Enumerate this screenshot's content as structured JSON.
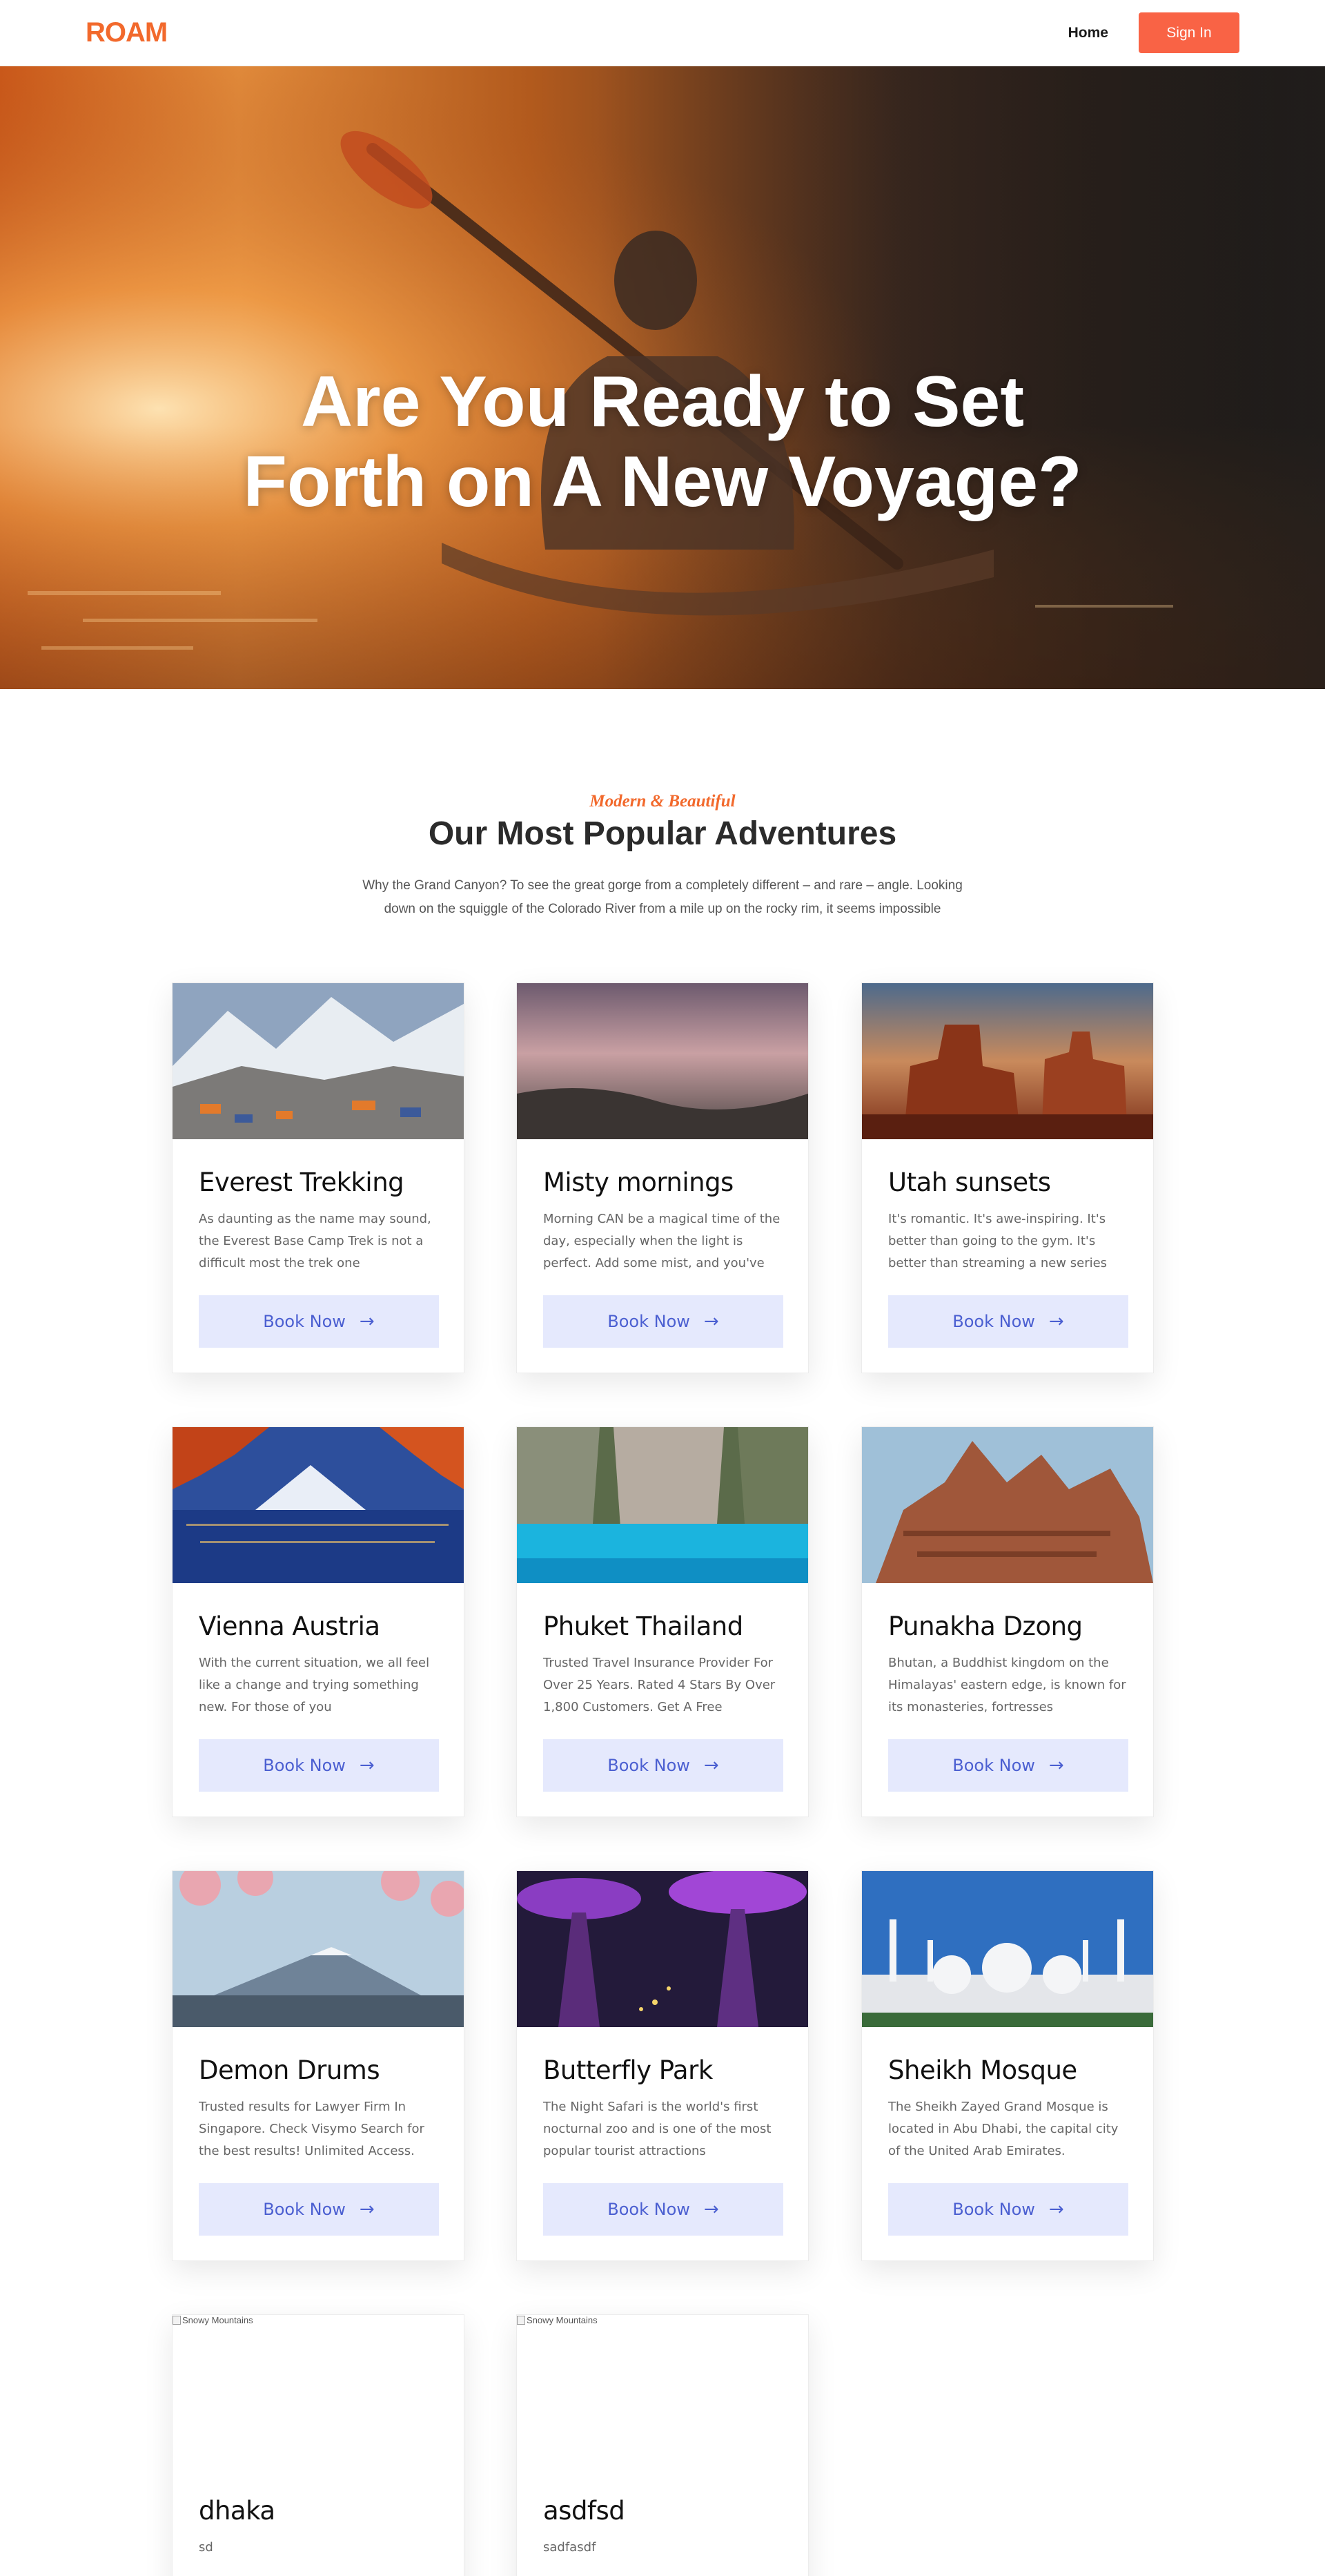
{
  "nav": {
    "logo": "ROAM",
    "home": "Home",
    "sign_in": "Sign In"
  },
  "hero": {
    "title": "Are You Ready to Set Forth on A New Voyage?"
  },
  "section": {
    "eyebrow": "Modern & Beautiful",
    "title": "Our Most Popular Adventures",
    "description": "Why the Grand Canyon? To see the great gorge from a completely different – and rare – angle. Looking down on the squiggle of the Colorado River from a mile up on the rocky rim, it seems impossible"
  },
  "cards": [
    {
      "title": "Everest Trekking",
      "text": "As daunting as the name may sound, the Everest Base Camp Trek is not a difficult most the trek one",
      "button": "Book Now",
      "image": "snowy-mountain-camp"
    },
    {
      "title": "Misty mornings",
      "text": "Morning CAN be a magical time of the day, especially when the light is perfect. Add some mist, and you've",
      "button": "Book Now",
      "image": "misty-landscape"
    },
    {
      "title": "Utah sunsets",
      "text": "It's romantic. It's awe-inspiring. It's better than going to the gym. It's better than streaming a new series",
      "button": "Book Now",
      "image": "desert-buttes"
    },
    {
      "title": "Vienna Austria",
      "text": "With the current situation, we all feel like a change and trying something new. For those of you",
      "button": "Book Now",
      "image": "mountain-lake-autumn"
    },
    {
      "title": "Phuket Thailand",
      "text": "Trusted Travel Insurance Provider For Over 25 Years. Rated 4 Stars By Over 1,800 Customers. Get A Free",
      "button": "Book Now",
      "image": "turquoise-lagoon"
    },
    {
      "title": "Punakha Dzong",
      "text": "Bhutan, a Buddhist kingdom on the Himalayas' eastern edge, is known for its monasteries, fortresses",
      "button": "Book Now",
      "image": "carved-wooden-temple"
    },
    {
      "title": "Demon Drums",
      "text": "Trusted results for Lawyer Firm In Singapore. Check Visymo Search for the best results! Unlimited Access.",
      "button": "Book Now",
      "image": "cherry-blossom-mountain"
    },
    {
      "title": "Butterfly Park",
      "text": "The Night Safari is the world's first nocturnal zoo and is one of the most popular tourist attractions",
      "button": "Book Now",
      "image": "supertree-grove-night"
    },
    {
      "title": "Sheikh Mosque",
      "text": "The Sheikh Zayed Grand Mosque is located in Abu Dhabi, the capital city of the United Arab Emirates.",
      "button": "Book Now",
      "image": "white-mosque"
    },
    {
      "title": "dhaka",
      "text": "sd",
      "image_alt": "Snowy Mountains"
    },
    {
      "title": "asdfsd",
      "text": "sadfasdf",
      "image_alt": "Snowy Mountains"
    }
  ]
}
